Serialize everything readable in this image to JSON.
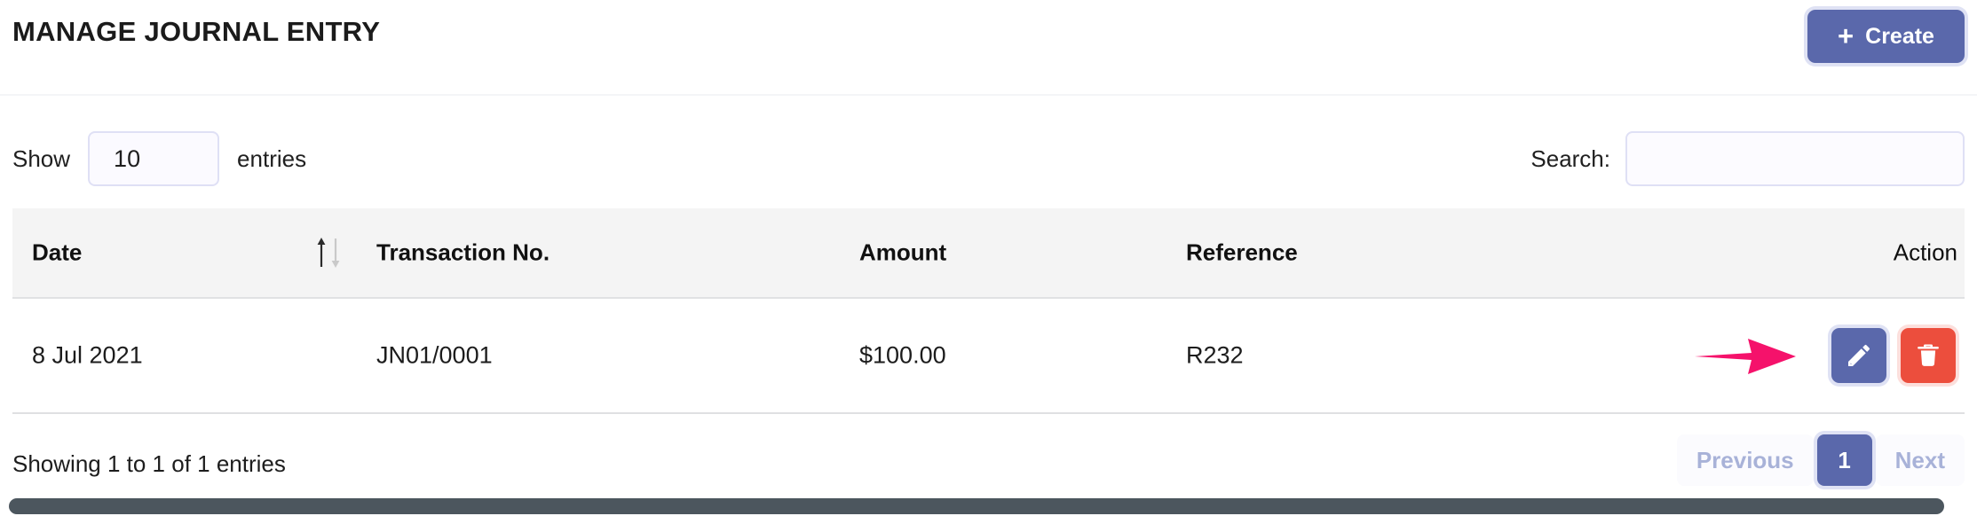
{
  "header": {
    "title": "MANAGE JOURNAL ENTRY",
    "create_label": "Create",
    "create_icon": "plus-icon",
    "create_color": "#5a68ab"
  },
  "controls": {
    "length_prefix": "Show",
    "length_value": "10",
    "length_suffix": "entries",
    "search_label": "Search:",
    "search_value": "",
    "search_placeholder": ""
  },
  "table": {
    "columns": [
      {
        "key": "date",
        "label": "Date",
        "sortable": true,
        "sort_icon": "sort-updown-icon",
        "align": "left"
      },
      {
        "key": "transaction_no",
        "label": "Transaction No.",
        "sortable": false,
        "align": "left"
      },
      {
        "key": "amount",
        "label": "Amount",
        "sortable": false,
        "align": "left"
      },
      {
        "key": "reference",
        "label": "Reference",
        "sortable": false,
        "align": "left"
      },
      {
        "key": "action",
        "label": "Action",
        "sortable": false,
        "align": "right"
      }
    ],
    "rows": [
      {
        "date": "8 Jul 2021",
        "transaction_no": "JN01/0001",
        "amount": "$100.00",
        "reference": "R232",
        "actions": [
          {
            "name": "edit-button",
            "icon": "pencil-icon",
            "color": "#5a68ab"
          },
          {
            "name": "delete-button",
            "icon": "trash-icon",
            "color": "#ec4e3d"
          }
        ]
      }
    ]
  },
  "annotation": {
    "type": "arrow",
    "color": "#f5126b",
    "points_to": "edit-button"
  },
  "footer": {
    "info": "Showing 1 to 1 of 1 entries",
    "pagination": {
      "previous_label": "Previous",
      "previous_disabled": true,
      "pages": [
        {
          "label": "1",
          "active": true
        }
      ],
      "next_label": "Next",
      "next_disabled": true,
      "active_color": "#5a68ab",
      "disabled_color": "#a8b2d8"
    }
  },
  "scrollbar": {
    "orientation": "horizontal",
    "thumb_color": "#4c565e"
  }
}
